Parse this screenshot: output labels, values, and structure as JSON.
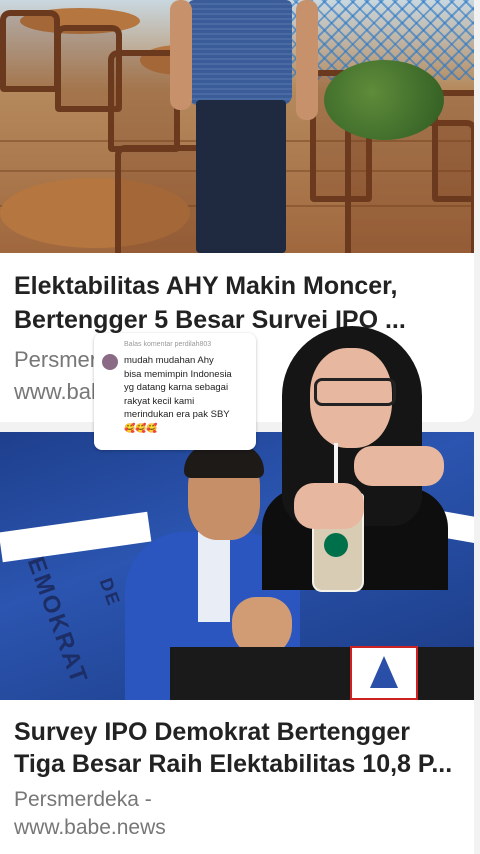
{
  "feed": {
    "cards": [
      {
        "title_line1": "Elektabilitas AHY Makin Moncer,",
        "title_line2": "Bertengger 5 Besar Survei IPO ...",
        "source_name": "Persmerdeka -",
        "source_url": "www.babe.news"
      },
      {
        "title_line1": "Survey IPO Demokrat Bertengger",
        "title_line2": "Tiga Besar Raih Elektabilitas 10,8 P...",
        "source_name": "Persmerdeka -",
        "source_url": "www.babe.news"
      }
    ],
    "photo2_side_text_left": "EMOKRAT",
    "photo2_side_text_right": "DE"
  },
  "comment_bubble": {
    "header": "Balas komentar perdilah803",
    "lines": [
      "mudah mudahan Ahy",
      "bisa memimpin Indonesia",
      "yg datang karna sebagai",
      "rakyat kecil kami",
      "merindukan era pak SBY",
      "🥰🥰🥰"
    ]
  }
}
